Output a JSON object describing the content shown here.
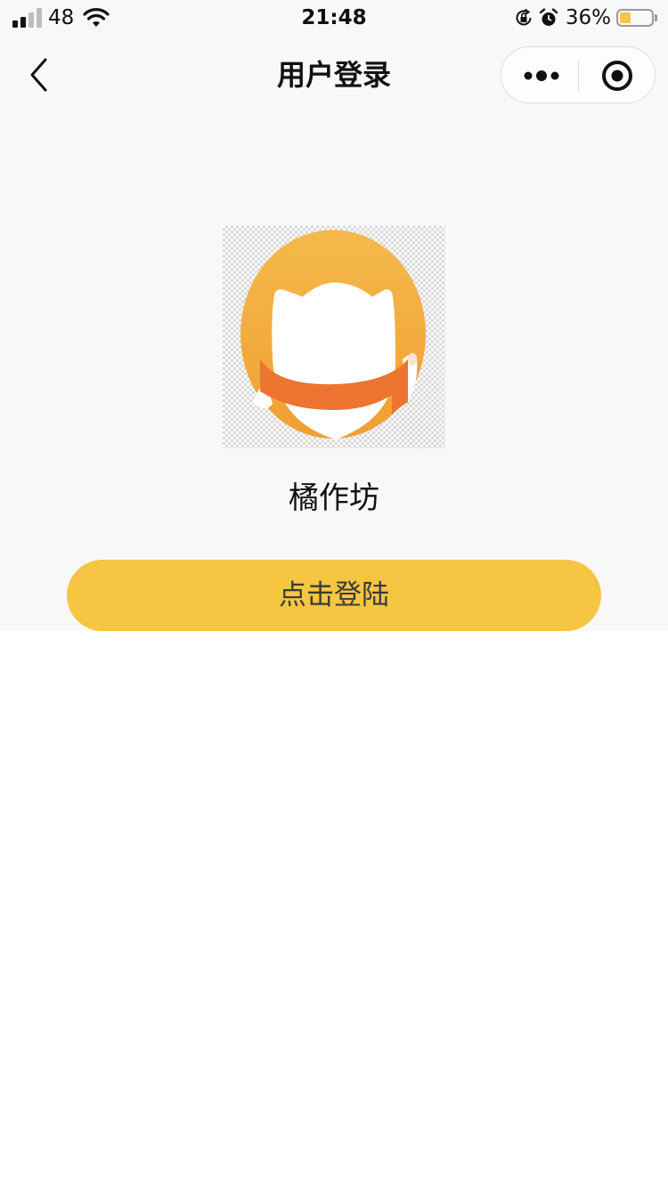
{
  "status_bar": {
    "carrier": "48",
    "time": "21:48",
    "battery_percent": "36%",
    "battery_level": 0.36,
    "icons": [
      "signal-icon",
      "wifi-icon",
      "rotation-lock-icon",
      "alarm-icon",
      "battery-icon"
    ]
  },
  "nav": {
    "title": "用户登录",
    "back_icon": "chevron-left-icon",
    "more_icon": "more-dots-icon",
    "close_icon": "target-circle-icon"
  },
  "main": {
    "app_name": "橘作坊",
    "login_label": "点击登陆"
  },
  "colors": {
    "accent": "#f6c542",
    "logo_orange": "#f2a93b",
    "scarf_orange": "#ed7431",
    "background": "#f8f8f8"
  }
}
